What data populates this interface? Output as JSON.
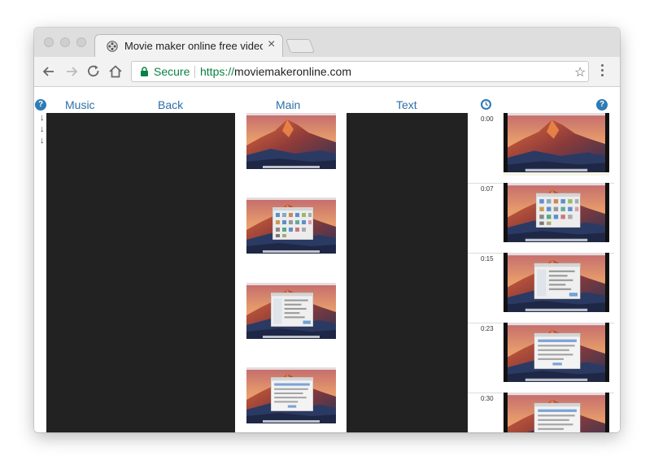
{
  "browser": {
    "tab_title": "Movie maker online free video",
    "tab_close": "×",
    "secure_label": "Secure",
    "url_protocol": "https://",
    "url_host": "moviemakeronline.com",
    "star_icon": "star-icon"
  },
  "editor": {
    "nav": {
      "music": "Music",
      "back": "Back",
      "main": "Main",
      "text": "Text"
    },
    "help_glyph": "?",
    "arrow_glyph": "↓",
    "timeline": {
      "times": [
        "0:00",
        "0:07",
        "0:15",
        "0:23",
        "0:30"
      ]
    }
  },
  "colors": {
    "link": "#2d6fa8",
    "track_bg": "#222222",
    "secure_green": "#0b8043",
    "help_blue": "#2d7bb7"
  }
}
